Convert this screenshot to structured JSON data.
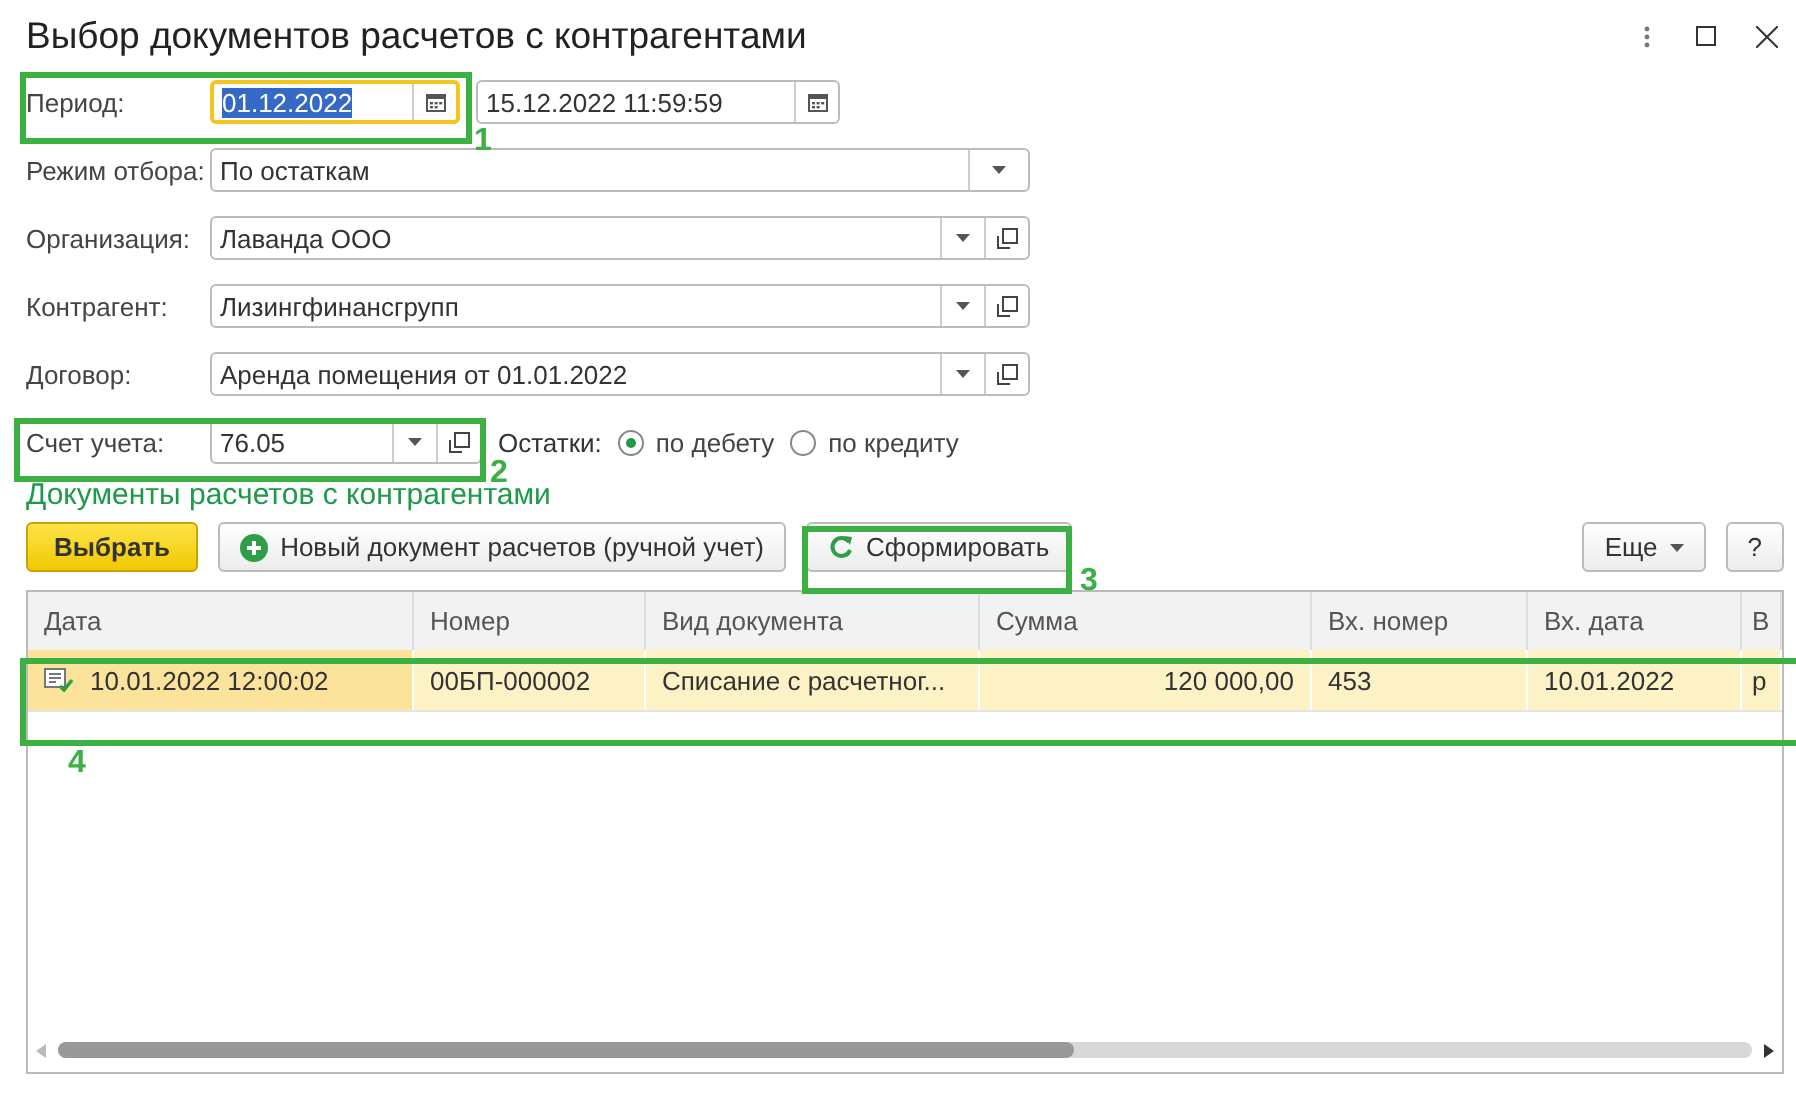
{
  "window": {
    "title": "Выбор документов расчетов с контрагентами"
  },
  "period": {
    "label": "Период:",
    "from": {
      "value": "01.12.2022",
      "focused": true
    },
    "to": {
      "value": "15.12.2022 11:59:59",
      "focused": false
    }
  },
  "fields": [
    {
      "label": "Режим отбора:",
      "value": "По остаткам",
      "kind": "select"
    },
    {
      "label": "Организация:",
      "value": "Лаванда ООО",
      "kind": "select_open"
    },
    {
      "label": "Контрагент:",
      "value": "Лизингфинансгрупп",
      "kind": "select_open"
    },
    {
      "label": "Договор:",
      "value": "Аренда помещения от 01.01.2022",
      "kind": "select_open"
    }
  ],
  "account": {
    "label": "Счет учета:",
    "value": "76.05",
    "kind": "select_open"
  },
  "balance": {
    "label": "Остатки:",
    "options": [
      {
        "label": "по дебету",
        "selected": true
      },
      {
        "label": "по кредиту",
        "selected": false
      }
    ]
  },
  "section_title": "Документы расчетов с контрагентами",
  "toolbar": [
    {
      "label": "Выбрать",
      "kind": "primary"
    },
    {
      "label": "Новый документ расчетов (ручной учет)",
      "kind": "add"
    },
    {
      "label": "Сформировать",
      "kind": "refresh"
    },
    {
      "label": "Еще",
      "kind": "more"
    },
    {
      "label": "?",
      "kind": "help"
    }
  ],
  "table": {
    "columns": [
      "Дата",
      "Номер",
      "Вид документа",
      "Сумма",
      "Вх. номер",
      "Вх. дата",
      "В"
    ],
    "rows": [
      {
        "selected": true,
        "cells": [
          "10.01.2022 12:00:02",
          "00БП-000002",
          "Списание с расчетног...",
          "120 000,00",
          "453",
          "10.01.2022",
          "р"
        ]
      }
    ]
  },
  "annotations": [
    "1",
    "2",
    "3",
    "4"
  ]
}
